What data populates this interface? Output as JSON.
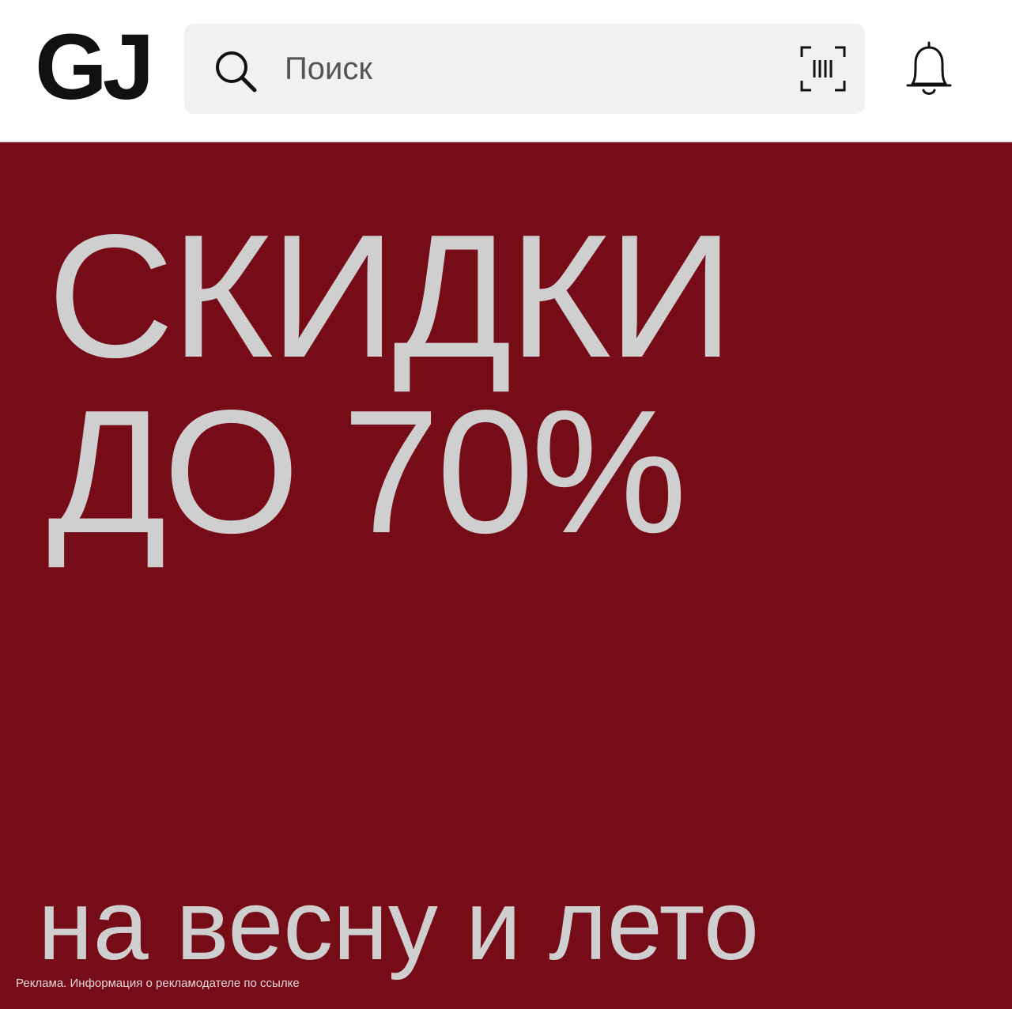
{
  "header": {
    "logo": "GJ",
    "search": {
      "placeholder": "Поиск",
      "icon": "search-icon"
    },
    "barcode_icon": "barcode-scan-icon",
    "bell_icon": "bell-icon"
  },
  "banner": {
    "headline_line1": "СКИДКИ",
    "headline_line2": "ДО 70%",
    "subline": "на весну и лето",
    "disclaimer": "Реклама. Информация о рекламодателе по ссылке",
    "background": "#760c18",
    "text_color": "#cfcfcf"
  }
}
